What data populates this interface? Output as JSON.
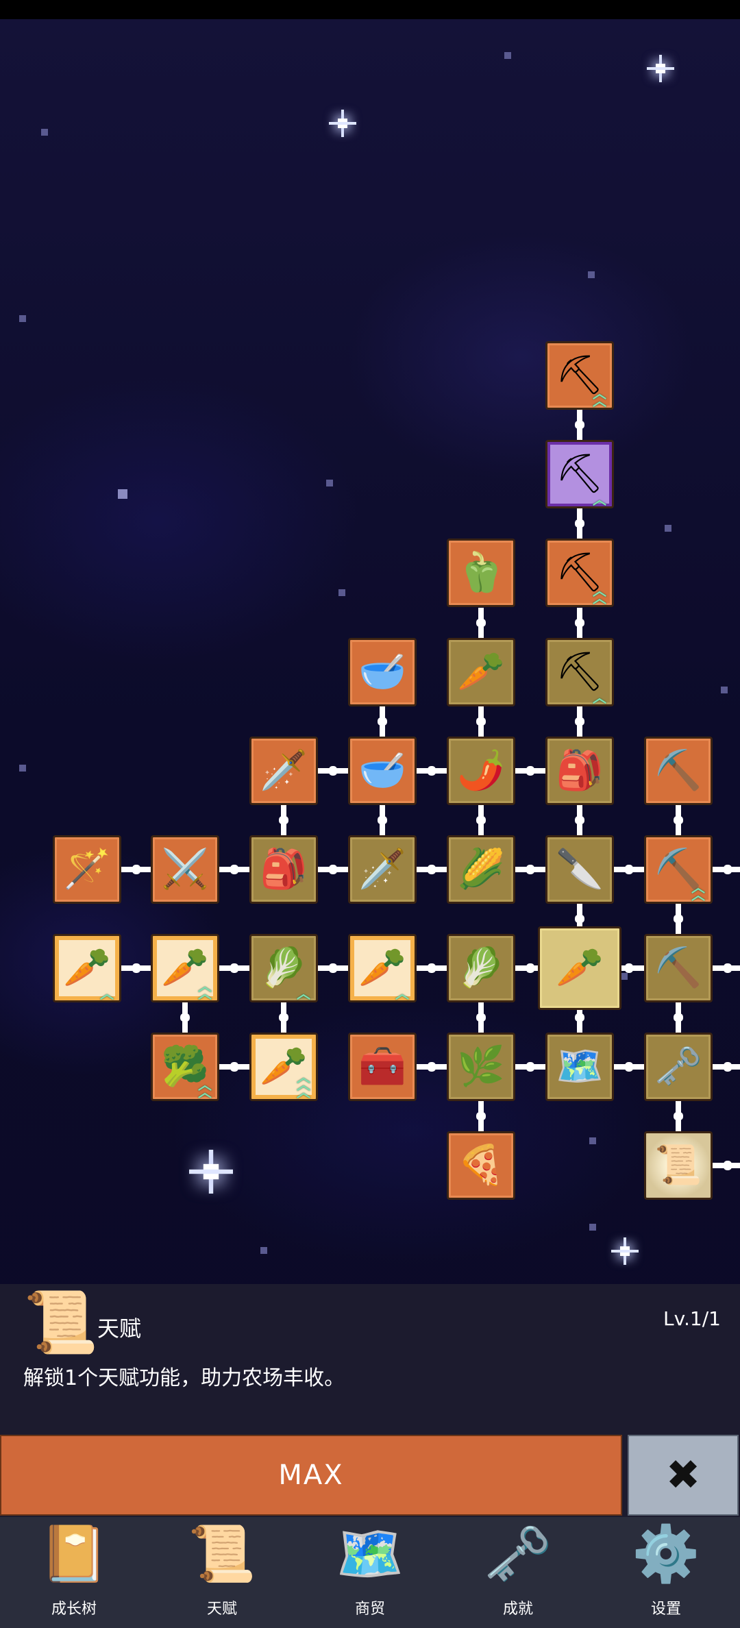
{
  "panel": {
    "talent_icon": "scroll-icon",
    "talent_name": "天赋",
    "level": "Lv.1/1",
    "description": "解锁1个天赋功能，助力农场丰收。",
    "max_label": "MAX",
    "close_label": "✖"
  },
  "nav": {
    "items": [
      {
        "label": "成长树",
        "icon": "book-icon",
        "glyph": "📔"
      },
      {
        "label": "天赋",
        "icon": "scroll-icon",
        "glyph": "📜"
      },
      {
        "label": "商贸",
        "icon": "map-icon",
        "glyph": "🗺️"
      },
      {
        "label": "成就",
        "icon": "key-icon",
        "glyph": "🗝️"
      },
      {
        "label": "设置",
        "icon": "gear-icon",
        "glyph": "⚙️"
      }
    ]
  },
  "tree": {
    "nodes": [
      {
        "name": "shovel-upgrade-node",
        "icon": "shovel-icon",
        "glyph": "⛏",
        "style": "orange",
        "upgrade": "double"
      },
      {
        "name": "shovel-upgrade-node",
        "icon": "shovel-icon",
        "glyph": "⛏",
        "style": "purple",
        "upgrade": "single"
      },
      {
        "name": "shovel-upgrade-node",
        "icon": "shovel-icon",
        "glyph": "⛏",
        "style": "orange",
        "upgrade": "double"
      },
      {
        "name": "pepper-node",
        "icon": "bell-pepper-icon",
        "glyph": "🫑",
        "style": "orange",
        "upgrade": ""
      },
      {
        "name": "bowl-node",
        "icon": "bowl-icon",
        "glyph": "🥣",
        "style": "orange",
        "upgrade": ""
      },
      {
        "name": "radish-node",
        "icon": "radish-icon",
        "glyph": "🥕",
        "style": "gold",
        "upgrade": ""
      },
      {
        "name": "shovel-upgrade-node",
        "icon": "shovel-icon",
        "glyph": "⛏",
        "style": "gold",
        "upgrade": "single"
      },
      {
        "name": "sword-node",
        "icon": "golden-sword-icon",
        "glyph": "🗡️",
        "style": "orange",
        "upgrade": ""
      },
      {
        "name": "bowl-node",
        "icon": "bowl-icon",
        "glyph": "🥣",
        "style": "orange",
        "upgrade": ""
      },
      {
        "name": "chili-node",
        "icon": "chili-icon",
        "glyph": "🌶️",
        "style": "gold",
        "upgrade": ""
      },
      {
        "name": "backpack-node",
        "icon": "backpack-icon",
        "glyph": "🎒",
        "style": "gold",
        "upgrade": ""
      },
      {
        "name": "pickaxe-node",
        "icon": "pickaxe-icon",
        "glyph": "⛏️",
        "style": "orange",
        "upgrade": ""
      },
      {
        "name": "staff-node",
        "icon": "staff-icon",
        "glyph": "🪄",
        "style": "orange",
        "upgrade": ""
      },
      {
        "name": "sword-node",
        "icon": "sword-icon",
        "glyph": "⚔️",
        "style": "orange",
        "upgrade": ""
      },
      {
        "name": "backpack-node",
        "icon": "backpack-icon",
        "glyph": "🎒",
        "style": "gold",
        "upgrade": ""
      },
      {
        "name": "sword-node",
        "icon": "sword-icon",
        "glyph": "🗡️",
        "style": "gold",
        "upgrade": ""
      },
      {
        "name": "corn-node",
        "icon": "corn-icon",
        "glyph": "🌽",
        "style": "gold",
        "upgrade": ""
      },
      {
        "name": "dagger-node",
        "icon": "dagger-icon",
        "glyph": "🔪",
        "style": "gold",
        "upgrade": ""
      },
      {
        "name": "pickaxe-upgrade-node",
        "icon": "pickaxe-icon",
        "glyph": "⛏️",
        "style": "orange",
        "upgrade": "double"
      },
      {
        "name": "carrot-upgrade-node",
        "icon": "carrot-icon",
        "glyph": "🥕",
        "style": "glow",
        "upgrade": "single"
      },
      {
        "name": "carrot-upgrade-node",
        "icon": "carrot-icon",
        "glyph": "🥕",
        "style": "glow",
        "upgrade": "double"
      },
      {
        "name": "cabbage-upgrade-node",
        "icon": "cabbage-icon",
        "glyph": "🥬",
        "style": "gold",
        "upgrade": "single"
      },
      {
        "name": "carrot-upgrade-node",
        "icon": "carrot-icon",
        "glyph": "🥕",
        "style": "glow",
        "upgrade": "single"
      },
      {
        "name": "cabbage-node",
        "icon": "cabbage-icon",
        "glyph": "🥬",
        "style": "gold",
        "upgrade": ""
      },
      {
        "name": "carrot-root-node",
        "icon": "carrot-icon",
        "glyph": "🥕",
        "style": "light",
        "upgrade": ""
      },
      {
        "name": "pickaxe-node",
        "icon": "pickaxe-icon",
        "glyph": "⛏️",
        "style": "gold",
        "upgrade": ""
      },
      {
        "name": "broccoli-upgrade-node",
        "icon": "broccoli-icon",
        "glyph": "🥦",
        "style": "orange",
        "upgrade": "double"
      },
      {
        "name": "carrot-upgrade-node",
        "icon": "carrot-icon",
        "glyph": "🥕",
        "style": "glow",
        "upgrade": "triple"
      },
      {
        "name": "chest-node",
        "icon": "treasure-chest-icon",
        "glyph": "🧰",
        "style": "orange",
        "upgrade": ""
      },
      {
        "name": "leek-node",
        "icon": "leek-icon",
        "glyph": "🌿",
        "style": "gold",
        "upgrade": ""
      },
      {
        "name": "map-node",
        "icon": "map-icon",
        "glyph": "🗺️",
        "style": "gold",
        "upgrade": ""
      },
      {
        "name": "key-node",
        "icon": "key-icon",
        "glyph": "🗝️",
        "style": "gold",
        "upgrade": ""
      },
      {
        "name": "pizza-node",
        "icon": "pizza-icon",
        "glyph": "🍕",
        "style": "orange",
        "upgrade": ""
      },
      {
        "name": "talent-scroll-node",
        "icon": "scroll-icon",
        "glyph": "📜",
        "style": "selected",
        "upgrade": ""
      }
    ]
  }
}
